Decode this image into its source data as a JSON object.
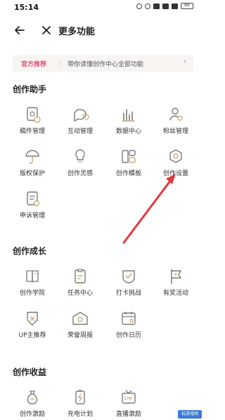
{
  "status_bar": {
    "time": "15:14",
    "battery": "86"
  },
  "header": {
    "title": "更多功能"
  },
  "banner": {
    "tag": "官方推荐",
    "text": "带你读懂创作中心全部功能",
    "arrow": "›"
  },
  "sections": [
    {
      "title": "创作助手",
      "items": [
        {
          "label": "稿件管理",
          "icon": "manuscript-icon"
        },
        {
          "label": "互动管理",
          "icon": "interaction-icon"
        },
        {
          "label": "数据中心",
          "icon": "bar-chart-icon"
        },
        {
          "label": "粉丝管理",
          "icon": "fans-icon"
        },
        {
          "label": "版权保护",
          "icon": "umbrella-icon"
        },
        {
          "label": "创作灵感",
          "icon": "lightbulb-icon"
        },
        {
          "label": "创作模板",
          "icon": "template-icon"
        },
        {
          "label": "创作设置",
          "icon": "settings-icon"
        },
        {
          "label": "申诉管理",
          "icon": "appeal-icon"
        }
      ]
    },
    {
      "title": "创作成长",
      "items": [
        {
          "label": "创作学院",
          "icon": "academy-icon"
        },
        {
          "label": "任务中心",
          "icon": "task-icon"
        },
        {
          "label": "打卡挑战",
          "icon": "checkin-icon"
        },
        {
          "label": "有奖活动",
          "icon": "flag-icon"
        },
        {
          "label": "UP主推荐",
          "icon": "recommend-icon"
        },
        {
          "label": "荣誉周报",
          "icon": "honor-icon"
        },
        {
          "label": "创作日历",
          "icon": "calendar-icon"
        }
      ]
    },
    {
      "title": "创作收益",
      "items": [
        {
          "label": "创作激励",
          "icon": "money-bag-icon"
        },
        {
          "label": "充电计划",
          "icon": "battery-charge-icon"
        },
        {
          "label": "直播激励",
          "icon": "live-icon"
        }
      ]
    }
  ],
  "watermark": "玩游戏网",
  "colors": {
    "accent": "#d9567a",
    "icon_stroke": "#7a7a7a",
    "icon_accent": "#c8a46a",
    "arrow": "#e0393e"
  }
}
